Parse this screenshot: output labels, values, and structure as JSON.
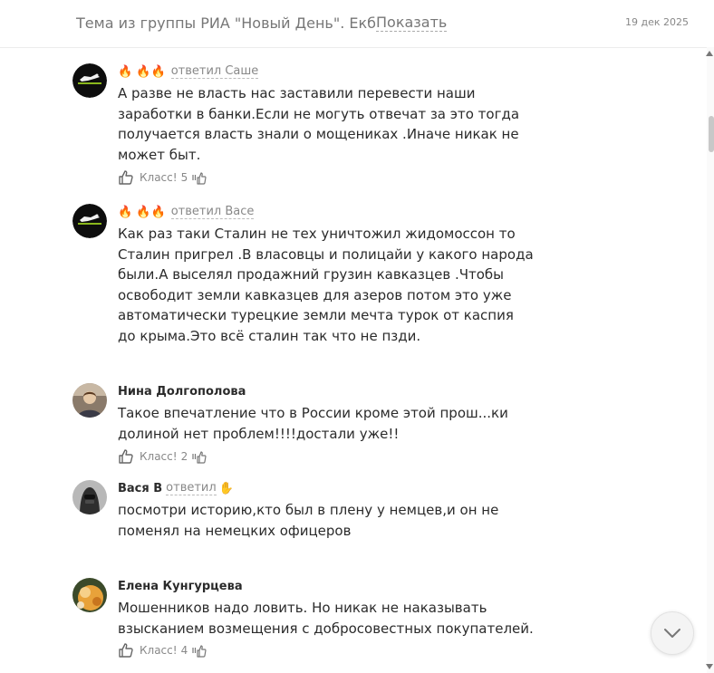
{
  "header": {
    "topic": "Тема из группы РИА \"Новый День\". Екб",
    "show_label": "Показать",
    "date": "19 дек 2025"
  },
  "comments": [
    {
      "author": "",
      "emoji": "🔥 🔥🔥",
      "replied": "ответил Саше",
      "text": "А разве не власть нас заставили перевести наши заработки в банки.Если не могуть отвечат за это тогда получается власть знали о мощениках .Иначе никак не может быт.",
      "klass_label": "Класс!",
      "klass_count": "5"
    },
    {
      "author": "",
      "emoji": "🔥 🔥🔥",
      "replied": "ответил Васе",
      "text": "Как раз таки Сталин не тех уничтожил жидомоссон то Сталин пригрел .В власовцы и полицайи у какого народа были.А выселял продажний грузин кавказцев .Чтобы освободит земли кавказцев для азеров потом это уже автоматически турецкие земли мечта турок от каспия до крыма.Это всё сталин так что не пзди."
    },
    {
      "author": "Нина Долгополова",
      "text": "Такое впечатление что в России кроме этой прош...ки долиной нет проблем!!!!достали уже!!",
      "klass_label": "Класс!",
      "klass_count": "2"
    },
    {
      "author": "Вася В",
      "replied": "ответил",
      "emoji_after": "✋",
      "text": "посмотри историю,кто был в плену у немцев,и он не поменял на немецких офицеров"
    },
    {
      "author": "Елена Кунгурцева",
      "text": "Мошенников надо ловить. Но никак не наказывать взысканием возмещения с добросовестных покупателей.",
      "klass_label": "Класс!",
      "klass_count": "4"
    }
  ],
  "icons": {
    "thumb": "thumbs-up-icon",
    "share": "class-share-icon",
    "scroll_down": "chevron-down-icon"
  },
  "colors": {
    "accent_text": "#888888",
    "fire": "#f07b1c"
  }
}
